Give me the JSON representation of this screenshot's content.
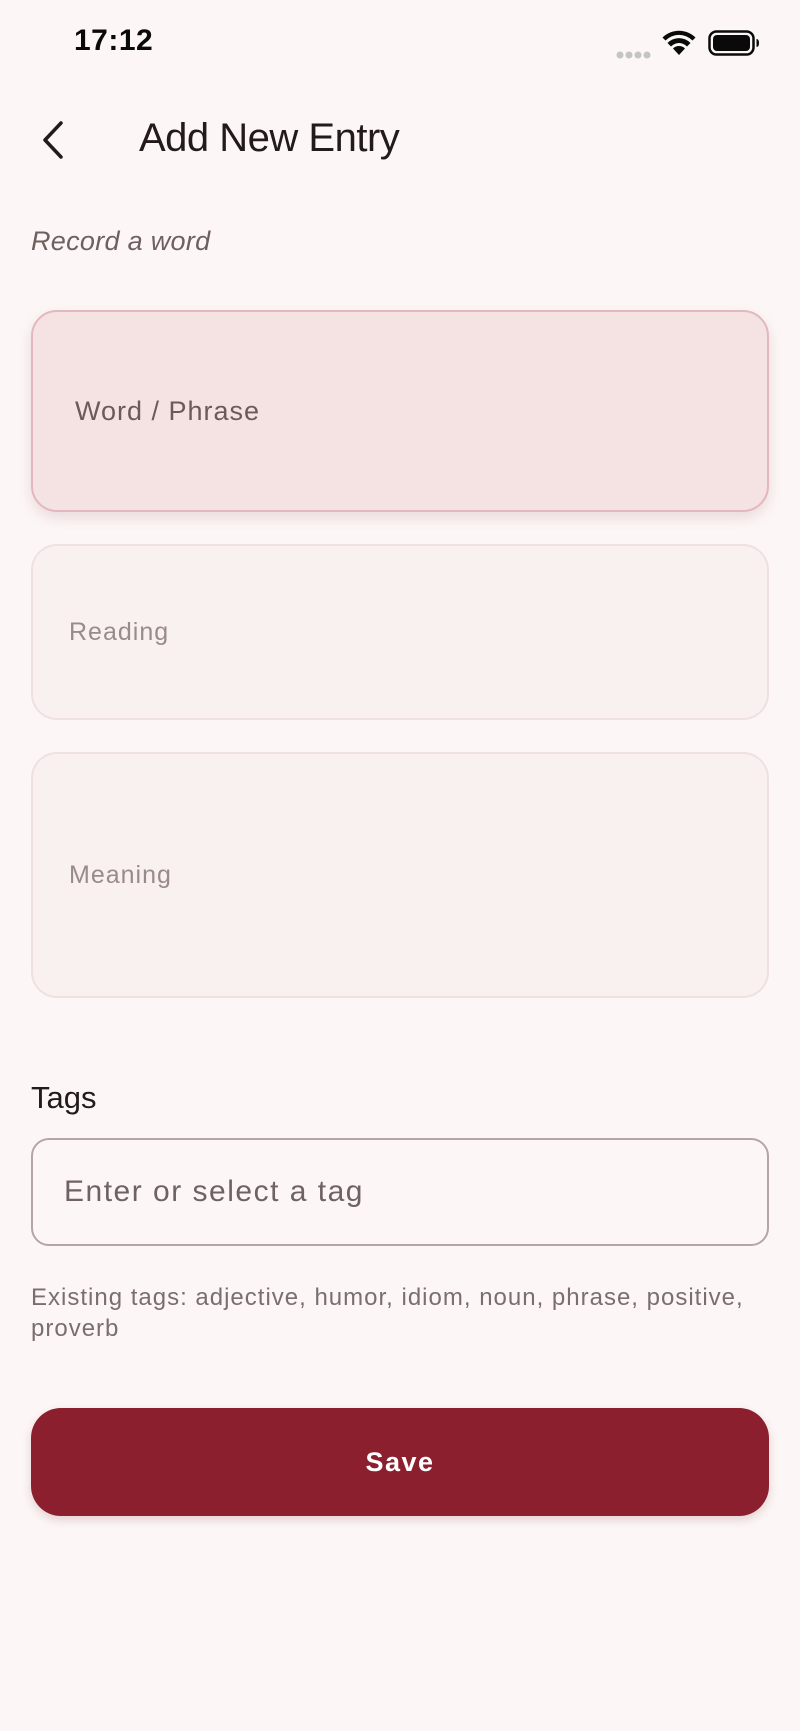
{
  "status_bar": {
    "time": "17:12"
  },
  "header": {
    "title": "Add New Entry",
    "back_icon": "chevron-left-icon"
  },
  "form": {
    "subtitle": "Record a word",
    "word_label": "Word / Phrase",
    "reading_label": "Reading",
    "meaning_label": "Meaning"
  },
  "tags": {
    "heading": "Tags",
    "input_placeholder": "Enter or select a tag",
    "existing_text": "Existing tags: adjective, humor, idiom, noun, phrase, positive, proverb"
  },
  "actions": {
    "save_label": "Save"
  },
  "colors": {
    "background": "#fcf7f6",
    "accent": "#8b1f2e",
    "focused_field": "#f5e3e4",
    "field": "#f8f1ef"
  }
}
